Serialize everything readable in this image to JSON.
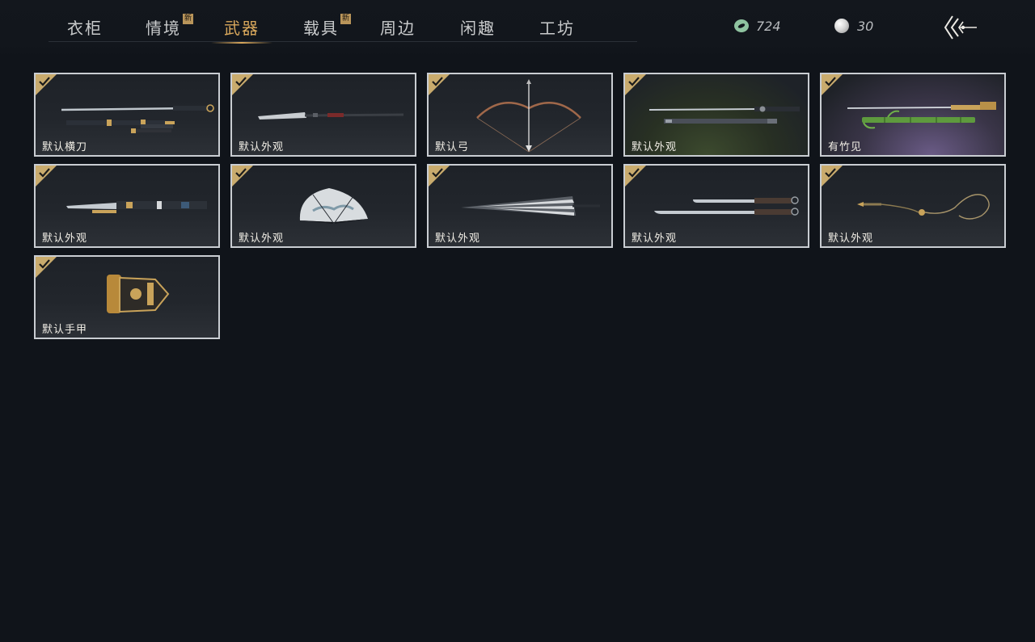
{
  "tabs": [
    {
      "label": "衣柜",
      "is_new": false,
      "active": false
    },
    {
      "label": "情境",
      "is_new": true,
      "active": false
    },
    {
      "label": "武器",
      "is_new": false,
      "active": true
    },
    {
      "label": "载具",
      "is_new": true,
      "active": false
    },
    {
      "label": "周边",
      "is_new": false,
      "active": false
    },
    {
      "label": "闲趣",
      "is_new": false,
      "active": false
    },
    {
      "label": "工坊",
      "is_new": false,
      "active": false
    }
  ],
  "new_badge_text": "新",
  "currency": {
    "jade": {
      "icon": "jade-coin-icon",
      "value": "724"
    },
    "pearl": {
      "icon": "pearl-icon",
      "value": "30"
    }
  },
  "back_icon": "back-arrow-icon",
  "accent_color": "#d9a85c",
  "items": [
    {
      "label": "默认横刀",
      "equipped": true,
      "icon": "saber-icon"
    },
    {
      "label": "默认外观",
      "equipped": true,
      "icon": "spear-icon"
    },
    {
      "label": "默认弓",
      "equipped": true,
      "icon": "bow-icon"
    },
    {
      "label": "默认外观",
      "equipped": true,
      "icon": "twin-sword-icon"
    },
    {
      "label": "有竹见",
      "equipped": true,
      "icon": "bamboo-sword-icon"
    },
    {
      "label": "默认外观",
      "equipped": true,
      "icon": "dagger-icon"
    },
    {
      "label": "默认外观",
      "equipped": true,
      "icon": "fan-icon"
    },
    {
      "label": "默认外观",
      "equipped": true,
      "icon": "umbrella-icon"
    },
    {
      "label": "默认外观",
      "equipped": true,
      "icon": "dual-blades-icon"
    },
    {
      "label": "默认外观",
      "equipped": true,
      "icon": "rope-dart-icon"
    },
    {
      "label": "默认手甲",
      "equipped": true,
      "icon": "gauntlet-icon"
    }
  ]
}
